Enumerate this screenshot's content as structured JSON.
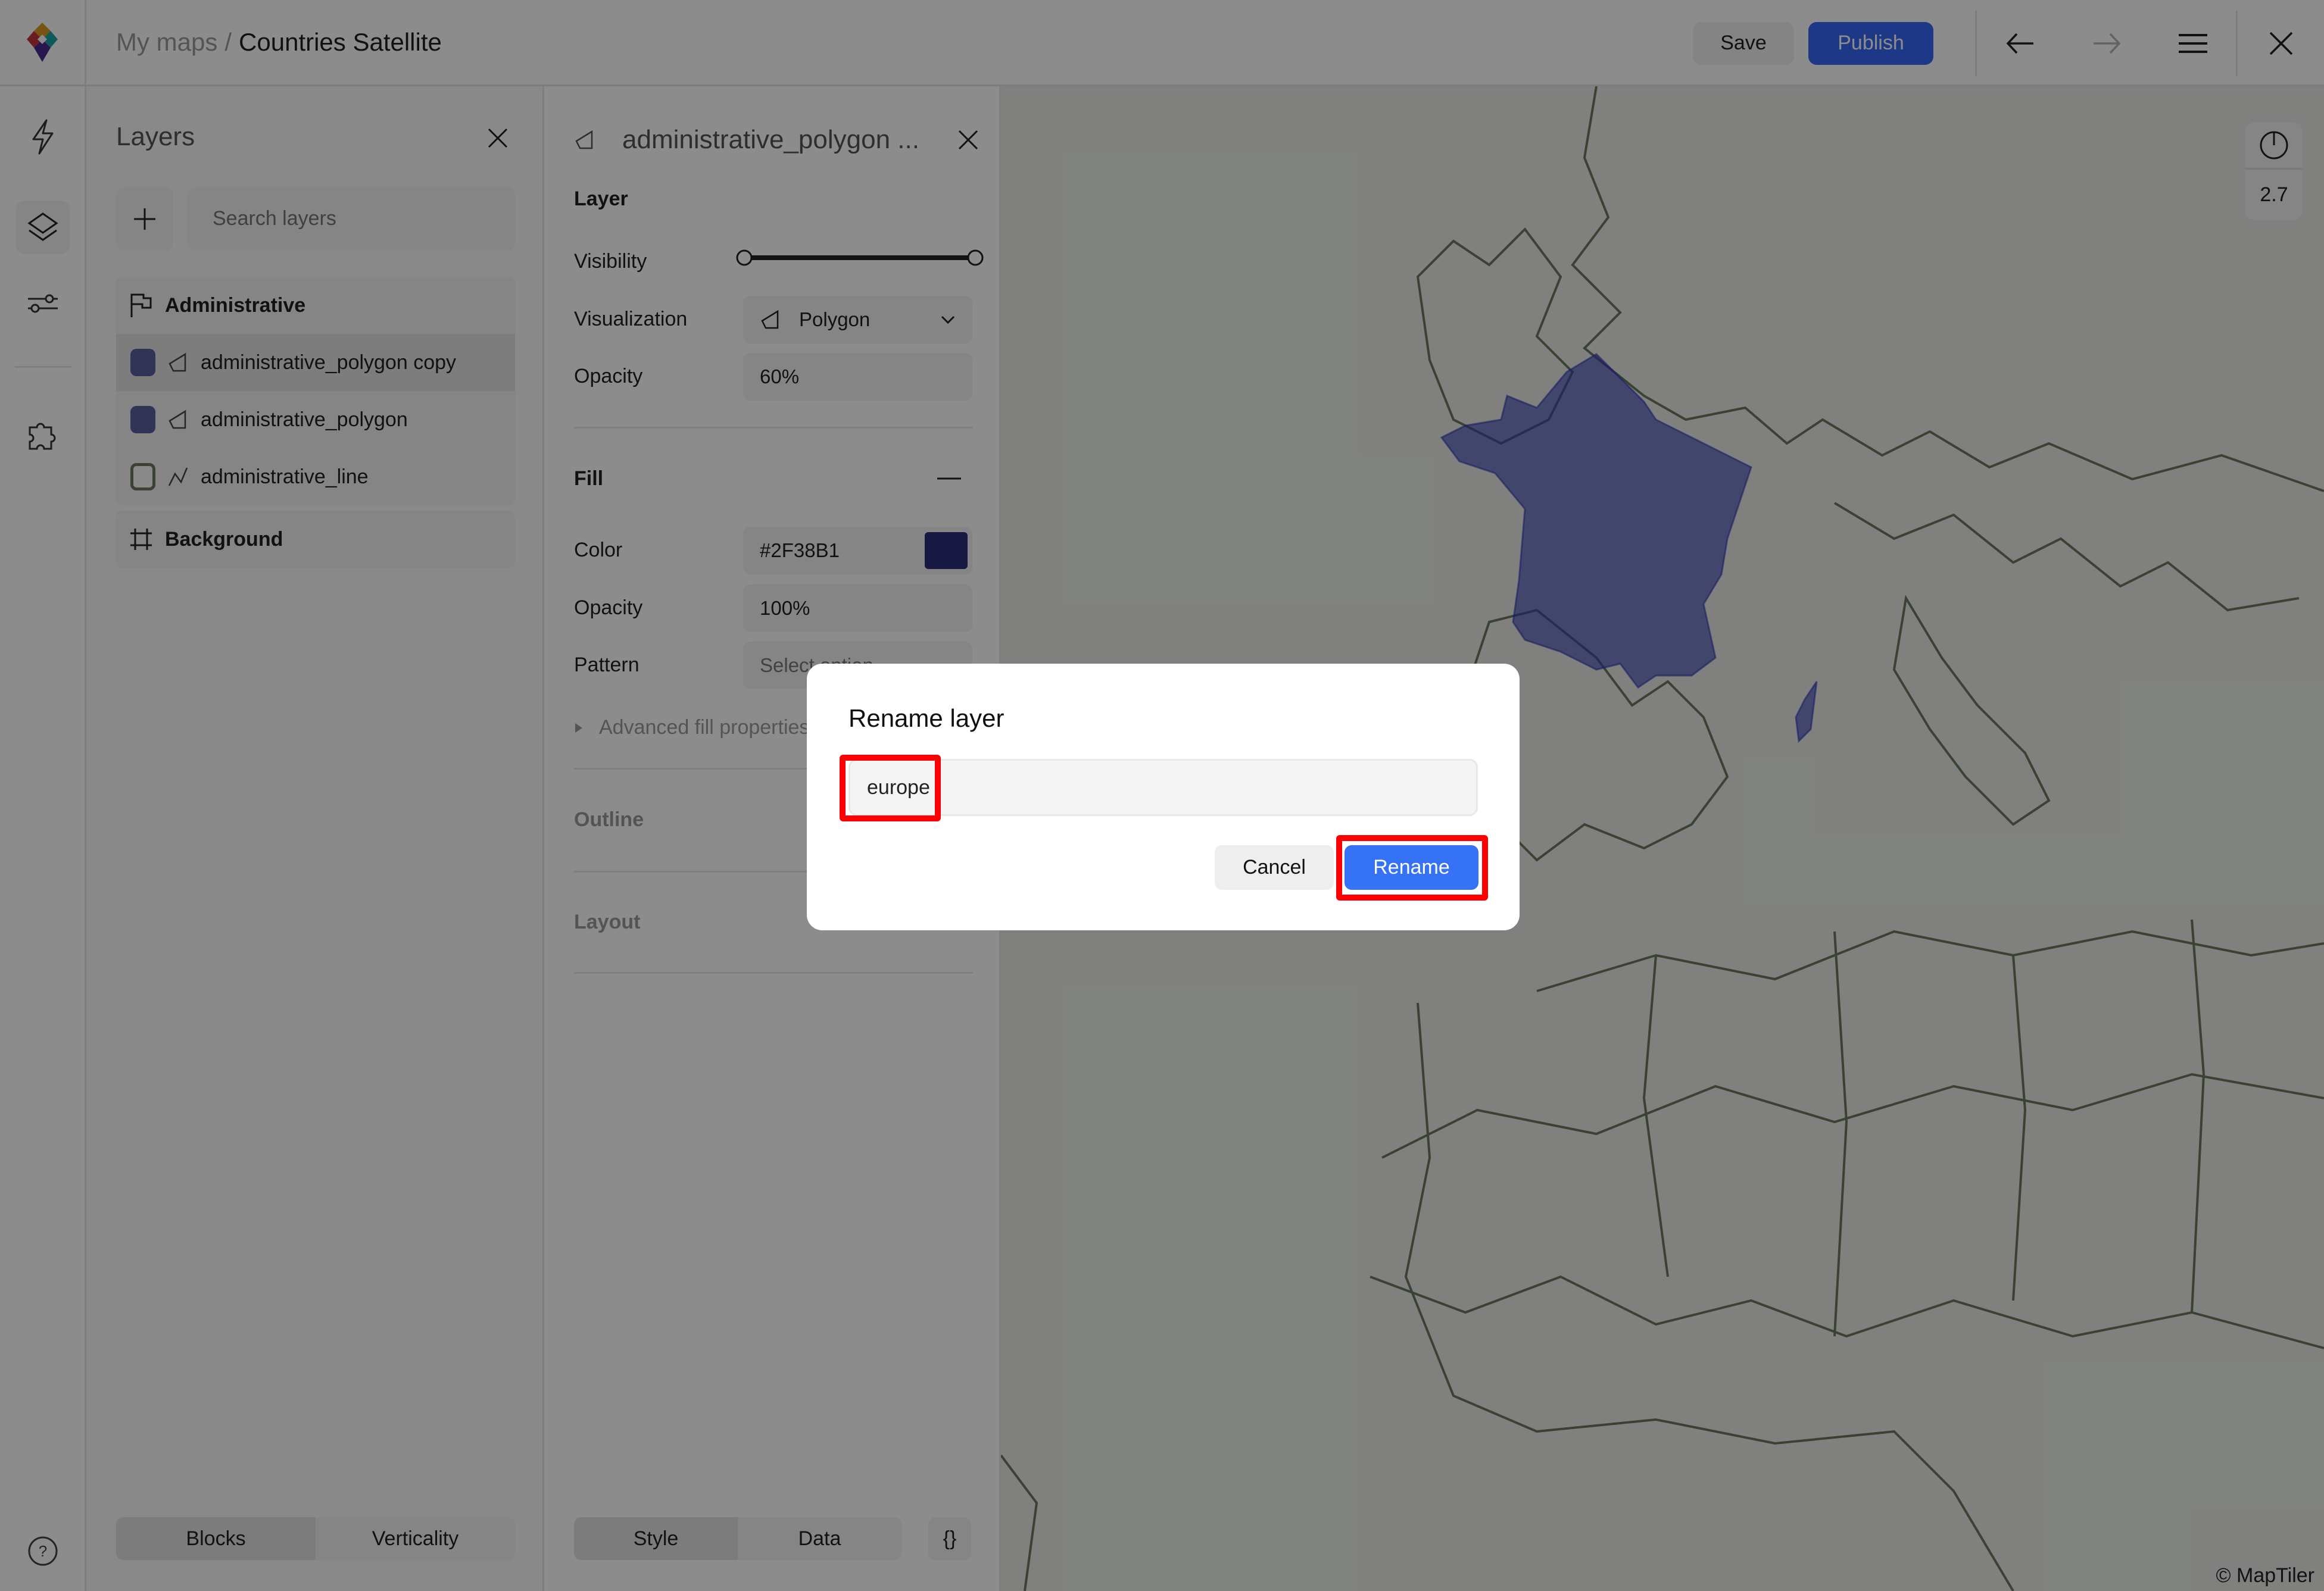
{
  "topbar": {
    "breadcrumb_parent": "My maps",
    "breadcrumb_separator": "/",
    "title": "Countries Satellite",
    "save_label": "Save",
    "publish_label": "Publish",
    "icons": [
      "back-arrow-icon",
      "forward-arrow-icon",
      "menu-icon",
      "close-icon"
    ]
  },
  "rail": {
    "items": [
      "lightning-icon",
      "layers-icon",
      "sliders-icon",
      "puzzle-icon"
    ],
    "active": "layers-icon",
    "help_icon": "help-icon"
  },
  "layers_panel": {
    "title": "Layers",
    "search_placeholder": "Search layers",
    "groups": [
      {
        "name": "Administrative",
        "icon": "flag-icon",
        "layers": [
          {
            "name": "administrative_polygon copy",
            "type": "polygon",
            "color": "#5a5e9e",
            "selected": true
          },
          {
            "name": "administrative_polygon",
            "type": "polygon",
            "color": "#5a5e9e",
            "selected": false
          },
          {
            "name": "administrative_line",
            "type": "line",
            "color": "#6b7a5e",
            "selected": false
          }
        ]
      },
      {
        "name": "Background",
        "icon": "frame-icon",
        "layers": []
      }
    ],
    "tabs": [
      "Blocks",
      "Verticality"
    ],
    "active_tab": "Blocks"
  },
  "props_panel": {
    "title": "administrative_polygon ...",
    "layer_section": "Layer",
    "visibility_label": "Visibility",
    "visualization_label": "Visualization",
    "visualization_value": "Polygon",
    "opacity_label": "Opacity",
    "opacity_value": "60%",
    "fill_section": "Fill",
    "color_label": "Color",
    "color_value": "#2F38B1",
    "fill_opacity_label": "Opacity",
    "fill_opacity_value": "100%",
    "pattern_label": "Pattern",
    "pattern_placeholder": "Select option",
    "advanced_label": "Advanced fill properties",
    "outline_section": "Outline",
    "layout_section": "Layout",
    "tabs": [
      "Style",
      "Data"
    ],
    "active_tab": "Style",
    "json_label": "{}"
  },
  "map": {
    "zoom_level": "2.7",
    "attribution": "© MapTiler",
    "highlight_color": "#2F38B1",
    "border_color": "#6b7a5e"
  },
  "dialog": {
    "title": "Rename layer",
    "input_value": "europe",
    "cancel_label": "Cancel",
    "rename_label": "Rename"
  }
}
